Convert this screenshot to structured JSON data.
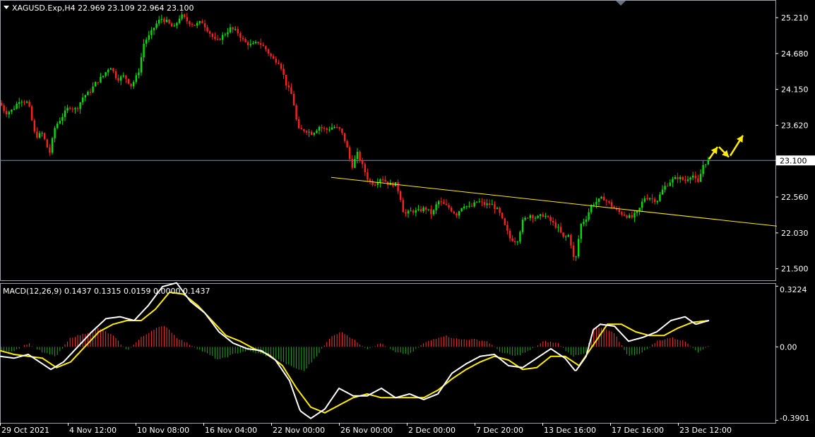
{
  "header": {
    "symbol_line": "XAGUSD.Exp,H4  22.969 23.109 22.964 23.100",
    "macd_line": "MACD(12,26,9) 0.1437 0.1315 0.0159 0.0000 0.1437"
  },
  "colors": {
    "background": "#000000",
    "bull": "#00e000",
    "bear": "#ff2020",
    "hist_up": "#ff3333",
    "hist_down": "#22aa22",
    "macd_line": "#ffffff",
    "signal_line": "#ffee00",
    "trendline": "#ffee00",
    "price_line": "#8090b0"
  },
  "chart_data": [
    {
      "type": "candlestick",
      "title": "XAGUSD.Exp,H4",
      "last": {
        "open": 22.969,
        "high": 23.109,
        "low": 22.964,
        "close": 23.1
      },
      "current_price_label": "23.100",
      "y_ticks": [
        "25.210",
        "24.680",
        "24.150",
        "23.620",
        "23.100",
        "22.560",
        "22.030",
        "21.500"
      ],
      "ylim": [
        21.34,
        25.45
      ],
      "x_ticks": [
        "29 Oct 2021",
        "4 Nov 12:00",
        "10 Nov 08:00",
        "16 Nov 04:00",
        "22 Nov 00:00",
        "26 Nov 00:00",
        "2 Dec 00:00",
        "7 Dec 20:00",
        "13 Dec 16:00",
        "17 Dec 16:00",
        "23 Dec 12:00"
      ],
      "close_path": [
        [
          0,
          23.95
        ],
        [
          8,
          23.8
        ],
        [
          18,
          23.85
        ],
        [
          28,
          24.0
        ],
        [
          40,
          23.95
        ],
        [
          50,
          23.45
        ],
        [
          60,
          23.5
        ],
        [
          70,
          23.2
        ],
        [
          78,
          23.6
        ],
        [
          88,
          23.75
        ],
        [
          98,
          23.9
        ],
        [
          108,
          23.85
        ],
        [
          118,
          24.05
        ],
        [
          126,
          24.1
        ],
        [
          136,
          24.25
        ],
        [
          146,
          24.35
        ],
        [
          156,
          24.5
        ],
        [
          166,
          24.3
        ],
        [
          176,
          24.35
        ],
        [
          186,
          24.2
        ],
        [
          196,
          24.4
        ],
        [
          204,
          24.85
        ],
        [
          212,
          24.95
        ],
        [
          220,
          25.1
        ],
        [
          228,
          25.2
        ],
        [
          236,
          25.15
        ],
        [
          246,
          25.05
        ],
        [
          256,
          25.25
        ],
        [
          266,
          25.15
        ],
        [
          276,
          25.1
        ],
        [
          286,
          25.15
        ],
        [
          296,
          25.0
        ],
        [
          306,
          24.85
        ],
        [
          316,
          24.95
        ],
        [
          326,
          25.05
        ],
        [
          336,
          25.0
        ],
        [
          346,
          24.85
        ],
        [
          356,
          24.8
        ],
        [
          366,
          24.85
        ],
        [
          376,
          24.75
        ],
        [
          386,
          24.6
        ],
        [
          396,
          24.55
        ],
        [
          406,
          24.2
        ],
        [
          414,
          24.05
        ],
        [
          422,
          23.55
        ],
        [
          432,
          23.55
        ],
        [
          442,
          23.5
        ],
        [
          452,
          23.6
        ],
        [
          462,
          23.55
        ],
        [
          472,
          23.6
        ],
        [
          482,
          23.55
        ],
        [
          490,
          23.35
        ],
        [
          498,
          23.0
        ],
        [
          506,
          23.2
        ],
        [
          514,
          23.0
        ],
        [
          522,
          22.8
        ],
        [
          530,
          22.75
        ],
        [
          540,
          22.85
        ],
        [
          550,
          22.75
        ],
        [
          560,
          22.75
        ],
        [
          566,
          22.6
        ],
        [
          572,
          22.3
        ],
        [
          582,
          22.35
        ],
        [
          592,
          22.35
        ],
        [
          602,
          22.4
        ],
        [
          612,
          22.3
        ],
        [
          620,
          22.5
        ],
        [
          628,
          22.45
        ],
        [
          636,
          22.4
        ],
        [
          646,
          22.3
        ],
        [
          656,
          22.45
        ],
        [
          666,
          22.4
        ],
        [
          676,
          22.5
        ],
        [
          686,
          22.45
        ],
        [
          696,
          22.45
        ],
        [
          706,
          22.35
        ],
        [
          714,
          22.15
        ],
        [
          722,
          21.95
        ],
        [
          732,
          21.9
        ],
        [
          740,
          22.2
        ],
        [
          750,
          22.3
        ],
        [
          760,
          22.25
        ],
        [
          770,
          22.3
        ],
        [
          780,
          22.2
        ],
        [
          790,
          22.1
        ],
        [
          798,
          21.95
        ],
        [
          806,
          22.0
        ],
        [
          814,
          21.55
        ],
        [
          822,
          22.15
        ],
        [
          830,
          22.25
        ],
        [
          838,
          22.45
        ],
        [
          846,
          22.5
        ],
        [
          854,
          22.55
        ],
        [
          864,
          22.45
        ],
        [
          874,
          22.35
        ],
        [
          884,
          22.3
        ],
        [
          894,
          22.25
        ],
        [
          904,
          22.35
        ],
        [
          912,
          22.55
        ],
        [
          920,
          22.55
        ],
        [
          930,
          22.5
        ],
        [
          940,
          22.7
        ],
        [
          950,
          22.8
        ],
        [
          960,
          22.85
        ],
        [
          970,
          22.8
        ],
        [
          980,
          22.9
        ],
        [
          988,
          22.75
        ],
        [
          996,
          23.05
        ],
        [
          1004,
          23.1
        ]
      ],
      "trendline": {
        "start": [
          469,
          22.85
        ],
        "end": [
          1100,
          22.13
        ]
      },
      "forecast_arrows": [
        {
          "from": [
            1004,
            23.12
          ],
          "to": [
            1016,
            23.3
          ]
        },
        {
          "from": [
            1018,
            23.3
          ],
          "to": [
            1032,
            23.15
          ]
        },
        {
          "from": [
            1034,
            23.17
          ],
          "to": [
            1052,
            23.47
          ]
        }
      ]
    },
    {
      "type": "macd",
      "title": "MACD(12,26,9)",
      "values": {
        "macd": 0.1437,
        "signal": 0.1315,
        "histogram": 0.0159
      },
      "y_ticks": [
        "0.3224",
        "0.00",
        "-0.3901"
      ],
      "ylim": [
        -0.4,
        0.335
      ],
      "macd_path": [
        [
          0,
          -0.05
        ],
        [
          20,
          -0.06
        ],
        [
          40,
          -0.04
        ],
        [
          60,
          -0.09
        ],
        [
          72,
          -0.12
        ],
        [
          90,
          -0.08
        ],
        [
          110,
          0.0
        ],
        [
          130,
          0.08
        ],
        [
          150,
          0.15
        ],
        [
          170,
          0.16
        ],
        [
          190,
          0.14
        ],
        [
          210,
          0.22
        ],
        [
          230,
          0.32
        ],
        [
          250,
          0.34
        ],
        [
          270,
          0.24
        ],
        [
          290,
          0.18
        ],
        [
          310,
          0.08
        ],
        [
          330,
          0.02
        ],
        [
          350,
          -0.01
        ],
        [
          370,
          -0.02
        ],
        [
          390,
          -0.07
        ],
        [
          410,
          -0.18
        ],
        [
          425,
          -0.34
        ],
        [
          440,
          -0.38
        ],
        [
          460,
          -0.33
        ],
        [
          480,
          -0.22
        ],
        [
          500,
          -0.26
        ],
        [
          520,
          -0.26
        ],
        [
          540,
          -0.22
        ],
        [
          560,
          -0.27
        ],
        [
          580,
          -0.25
        ],
        [
          600,
          -0.28
        ],
        [
          620,
          -0.25
        ],
        [
          640,
          -0.14
        ],
        [
          660,
          -0.09
        ],
        [
          680,
          -0.05
        ],
        [
          700,
          -0.04
        ],
        [
          720,
          -0.1
        ],
        [
          740,
          -0.11
        ],
        [
          760,
          -0.06
        ],
        [
          780,
          -0.01
        ],
        [
          800,
          -0.06
        ],
        [
          815,
          -0.13
        ],
        [
          830,
          -0.05
        ],
        [
          840,
          0.09
        ],
        [
          850,
          0.12
        ],
        [
          870,
          0.11
        ],
        [
          890,
          0.03
        ],
        [
          910,
          0.05
        ],
        [
          930,
          0.08
        ],
        [
          950,
          0.14
        ],
        [
          970,
          0.16
        ],
        [
          985,
          0.12
        ],
        [
          1004,
          0.14
        ]
      ],
      "signal_path": [
        [
          0,
          -0.02
        ],
        [
          20,
          -0.04
        ],
        [
          40,
          -0.05
        ],
        [
          60,
          -0.06
        ],
        [
          80,
          -0.11
        ],
        [
          100,
          -0.08
        ],
        [
          120,
          0.0
        ],
        [
          140,
          0.08
        ],
        [
          160,
          0.12
        ],
        [
          180,
          0.14
        ],
        [
          200,
          0.14
        ],
        [
          220,
          0.2
        ],
        [
          240,
          0.29
        ],
        [
          260,
          0.28
        ],
        [
          280,
          0.22
        ],
        [
          300,
          0.14
        ],
        [
          320,
          0.06
        ],
        [
          340,
          0.03
        ],
        [
          360,
          -0.01
        ],
        [
          380,
          -0.04
        ],
        [
          400,
          -0.1
        ],
        [
          420,
          -0.22
        ],
        [
          440,
          -0.32
        ],
        [
          460,
          -0.35
        ],
        [
          480,
          -0.31
        ],
        [
          500,
          -0.27
        ],
        [
          520,
          -0.25
        ],
        [
          540,
          -0.27
        ],
        [
          560,
          -0.27
        ],
        [
          580,
          -0.27
        ],
        [
          600,
          -0.27
        ],
        [
          620,
          -0.23
        ],
        [
          640,
          -0.17
        ],
        [
          660,
          -0.12
        ],
        [
          680,
          -0.08
        ],
        [
          700,
          -0.05
        ],
        [
          720,
          -0.07
        ],
        [
          740,
          -0.12
        ],
        [
          760,
          -0.11
        ],
        [
          780,
          -0.05
        ],
        [
          800,
          -0.05
        ],
        [
          820,
          -0.1
        ],
        [
          840,
          0.01
        ],
        [
          860,
          0.12
        ],
        [
          880,
          0.12
        ],
        [
          900,
          0.08
        ],
        [
          920,
          0.06
        ],
        [
          940,
          0.06
        ],
        [
          960,
          0.1
        ],
        [
          980,
          0.13
        ],
        [
          1004,
          0.14
        ]
      ],
      "hist_path": [
        [
          0,
          -0.03
        ],
        [
          20,
          -0.02
        ],
        [
          40,
          0.02
        ],
        [
          60,
          -0.03
        ],
        [
          80,
          -0.05
        ],
        [
          100,
          0.05
        ],
        [
          120,
          0.07
        ],
        [
          140,
          0.1
        ],
        [
          160,
          0.06
        ],
        [
          180,
          -0.02
        ],
        [
          200,
          0.05
        ],
        [
          220,
          0.1
        ],
        [
          235,
          0.11
        ],
        [
          250,
          0.05
        ],
        [
          270,
          0.01
        ],
        [
          290,
          -0.03
        ],
        [
          310,
          -0.07
        ],
        [
          330,
          -0.04
        ],
        [
          350,
          -0.02
        ],
        [
          370,
          -0.04
        ],
        [
          390,
          -0.06
        ],
        [
          410,
          -0.1
        ],
        [
          430,
          -0.13
        ],
        [
          450,
          -0.04
        ],
        [
          470,
          0.06
        ],
        [
          485,
          0.08
        ],
        [
          500,
          0.04
        ],
        [
          520,
          -0.01
        ],
        [
          540,
          0.02
        ],
        [
          560,
          -0.03
        ],
        [
          580,
          -0.04
        ],
        [
          600,
          0.02
        ],
        [
          620,
          0.05
        ],
        [
          630,
          0.06
        ],
        [
          650,
          0.04
        ],
        [
          670,
          0.04
        ],
        [
          690,
          0.03
        ],
        [
          710,
          -0.03
        ],
        [
          730,
          -0.05
        ],
        [
          750,
          -0.02
        ],
        [
          770,
          0.03
        ],
        [
          790,
          0.02
        ],
        [
          810,
          -0.05
        ],
        [
          830,
          -0.03
        ],
        [
          840,
          0.1
        ],
        [
          855,
          0.1
        ],
        [
          870,
          0.07
        ],
        [
          890,
          -0.05
        ],
        [
          910,
          -0.03
        ],
        [
          930,
          0.03
        ],
        [
          950,
          0.05
        ],
        [
          970,
          0.03
        ],
        [
          990,
          -0.03
        ],
        [
          1004,
          0.01
        ]
      ]
    }
  ]
}
